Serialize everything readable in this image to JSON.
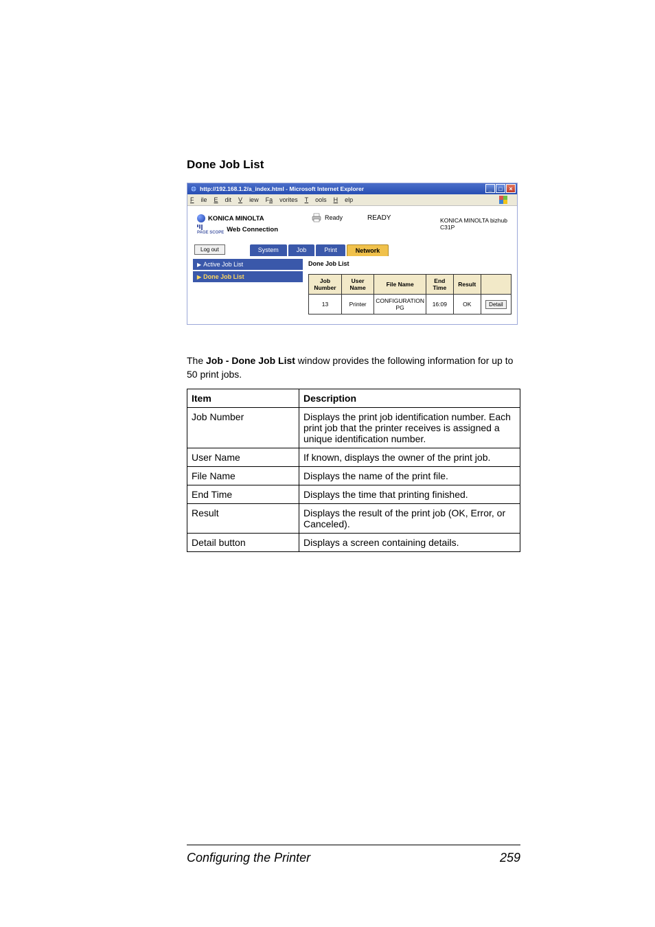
{
  "section_title": "Done Job List",
  "screenshot": {
    "window_title": "http://192.168.1.2/a_index.html - Microsoft Internet Explorer",
    "menubar": [
      "File",
      "Edit",
      "View",
      "Favorites",
      "Tools",
      "Help"
    ],
    "brand_line": "KONICA MINOLTA",
    "pagescope_label": "PAGE SCOPE",
    "web_connection": "Web Connection",
    "ready_small": "Ready",
    "ready_big": "READY",
    "model_line1": "KONICA MINOLTA bizhub",
    "model_line2": "C31P",
    "logout_label": "Log out",
    "tabs": {
      "system": "System",
      "job": "Job",
      "print": "Print",
      "network": "Network"
    },
    "sidebar": {
      "active_job_list": "Active Job List",
      "done_job_list": "Done Job List"
    },
    "panel_title": "Done Job List",
    "mini_table": {
      "headers": {
        "job_number": "Job Number",
        "user_name": "User Name",
        "file_name": "File Name",
        "end_time": "End Time",
        "result": "Result",
        "detail": ""
      },
      "row": {
        "job_number": "13",
        "user_name": "Printer",
        "file_name": "CONFIGURATION PG",
        "end_time": "16:09",
        "result": "OK",
        "detail_label": "Detail"
      }
    }
  },
  "body_para_pre": "The ",
  "body_para_bold": "Job - Done Job List",
  "body_para_post": " window provides the following information for up to 50 print jobs.",
  "desc_table": {
    "header_item": "Item",
    "header_desc": "Description",
    "rows": [
      {
        "item": "Job Number",
        "desc": "Displays the print job identification number. Each print job that the printer receives is assigned a unique identification number."
      },
      {
        "item": "User Name",
        "desc": "If known, displays the owner of the print job."
      },
      {
        "item": "File Name",
        "desc": "Displays the name of the print file."
      },
      {
        "item": "End Time",
        "desc": "Displays the time that printing finished."
      },
      {
        "item": "Result",
        "desc": "Displays the result of the print job (OK, Error, or Canceled)."
      },
      {
        "item": "Detail button",
        "desc": "Displays a screen containing details."
      }
    ]
  },
  "footer_title": "Configuring the Printer",
  "footer_page": "259"
}
